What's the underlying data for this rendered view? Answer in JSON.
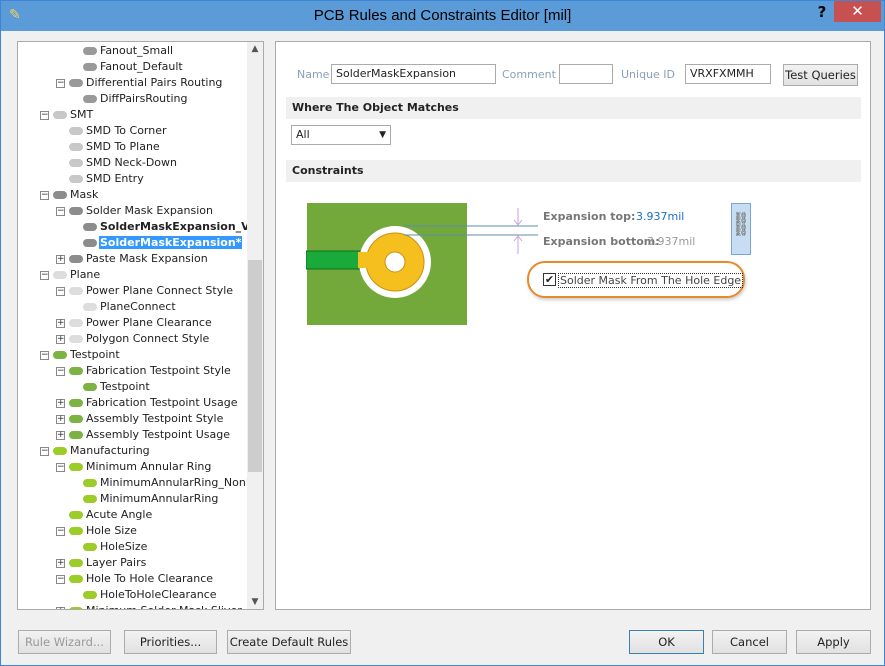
{
  "window": {
    "title": "PCB Rules and Constraints Editor [mil]",
    "help": "?",
    "close": "✕"
  },
  "tree": [
    {
      "level": 3,
      "label": "Fanout_Small",
      "icon": "fanout"
    },
    {
      "level": 3,
      "label": "Fanout_Default",
      "icon": "fanout"
    },
    {
      "level": 2,
      "label": "Differential Pairs Routing",
      "icon": "fanout",
      "exp": "−"
    },
    {
      "level": 3,
      "label": "DiffPairsRouting",
      "icon": "fanout"
    },
    {
      "level": 1,
      "label": "SMT",
      "icon": "smt",
      "exp": "−"
    },
    {
      "level": 2,
      "label": "SMD To Corner",
      "icon": "smt"
    },
    {
      "level": 2,
      "label": "SMD To Plane",
      "icon": "smt"
    },
    {
      "level": 2,
      "label": "SMD Neck-Down",
      "icon": "smt"
    },
    {
      "level": 2,
      "label": "SMD Entry",
      "icon": "smt"
    },
    {
      "level": 1,
      "label": "Mask",
      "icon": "mask",
      "exp": "−"
    },
    {
      "level": 2,
      "label": "Solder Mask Expansion",
      "icon": "mask",
      "exp": "−"
    },
    {
      "level": 3,
      "label": "SolderMaskExpansion_Vias*",
      "icon": "mask",
      "bold": true
    },
    {
      "level": 3,
      "label": "SolderMaskExpansion*",
      "icon": "mask",
      "bold": true,
      "selected": true
    },
    {
      "level": 2,
      "label": "Paste Mask Expansion",
      "icon": "mask",
      "exp": "+"
    },
    {
      "level": 1,
      "label": "Plane",
      "icon": "plane",
      "exp": "−"
    },
    {
      "level": 2,
      "label": "Power Plane Connect Style",
      "icon": "plane",
      "exp": "−"
    },
    {
      "level": 3,
      "label": "PlaneConnect",
      "icon": "plane"
    },
    {
      "level": 2,
      "label": "Power Plane Clearance",
      "icon": "plane",
      "exp": "+"
    },
    {
      "level": 2,
      "label": "Polygon Connect Style",
      "icon": "plane",
      "exp": "+"
    },
    {
      "level": 1,
      "label": "Testpoint",
      "icon": "testpoint",
      "exp": "−"
    },
    {
      "level": 2,
      "label": "Fabrication Testpoint Style",
      "icon": "testpoint",
      "exp": "−"
    },
    {
      "level": 3,
      "label": "Testpoint",
      "icon": "testpoint"
    },
    {
      "level": 2,
      "label": "Fabrication Testpoint Usage",
      "icon": "testpoint",
      "exp": "+"
    },
    {
      "level": 2,
      "label": "Assembly Testpoint Style",
      "icon": "testpoint",
      "exp": "+"
    },
    {
      "level": 2,
      "label": "Assembly Testpoint Usage",
      "icon": "testpoint",
      "exp": "+"
    },
    {
      "level": 1,
      "label": "Manufacturing",
      "icon": "mfg",
      "exp": "−"
    },
    {
      "level": 2,
      "label": "Minimum Annular Ring",
      "icon": "mfg",
      "exp": "−"
    },
    {
      "level": 3,
      "label": "MinimumAnnularRing_NonP",
      "icon": "mfg"
    },
    {
      "level": 3,
      "label": "MinimumAnnularRing",
      "icon": "mfg"
    },
    {
      "level": 2,
      "label": "Acute Angle",
      "icon": "mfg"
    },
    {
      "level": 2,
      "label": "Hole Size",
      "icon": "mfg",
      "exp": "−"
    },
    {
      "level": 3,
      "label": "HoleSize",
      "icon": "mfg"
    },
    {
      "level": 2,
      "label": "Layer Pairs",
      "icon": "mfg",
      "exp": "+"
    },
    {
      "level": 2,
      "label": "Hole To Hole Clearance",
      "icon": "mfg",
      "exp": "−"
    },
    {
      "level": 3,
      "label": "HoleToHoleClearance",
      "icon": "mfg"
    },
    {
      "level": 2,
      "label": "Minimum Solder Mask Sliver",
      "icon": "mfg",
      "exp": "+"
    }
  ],
  "rule": {
    "name_label": "Name",
    "name": "SolderMaskExpansion",
    "comment_label": "Comment",
    "comment": "",
    "uid_label": "Unique ID",
    "uid": "VRXFXMMH",
    "test_queries": "Test Queries"
  },
  "match": {
    "heading": "Where The Object Matches",
    "selected": "All"
  },
  "constraints": {
    "heading": "Constraints",
    "top_label": "Expansion top:",
    "top_value": "3.937mil",
    "bottom_label": "Expansion bottom:",
    "bottom_value": "3.937mil",
    "checkbox_label": "Solder Mask From The Hole Edge",
    "checked": true
  },
  "buttons": {
    "rule_wizard": "Rule Wizard...",
    "priorities": "Priorities...",
    "create_default": "Create Default Rules",
    "ok": "OK",
    "cancel": "Cancel",
    "apply": "Apply"
  },
  "colors": {
    "board": "#73a83a",
    "pad": "#f5bf1e",
    "track": "#1aaa3a",
    "highlight": "#e8892a"
  }
}
